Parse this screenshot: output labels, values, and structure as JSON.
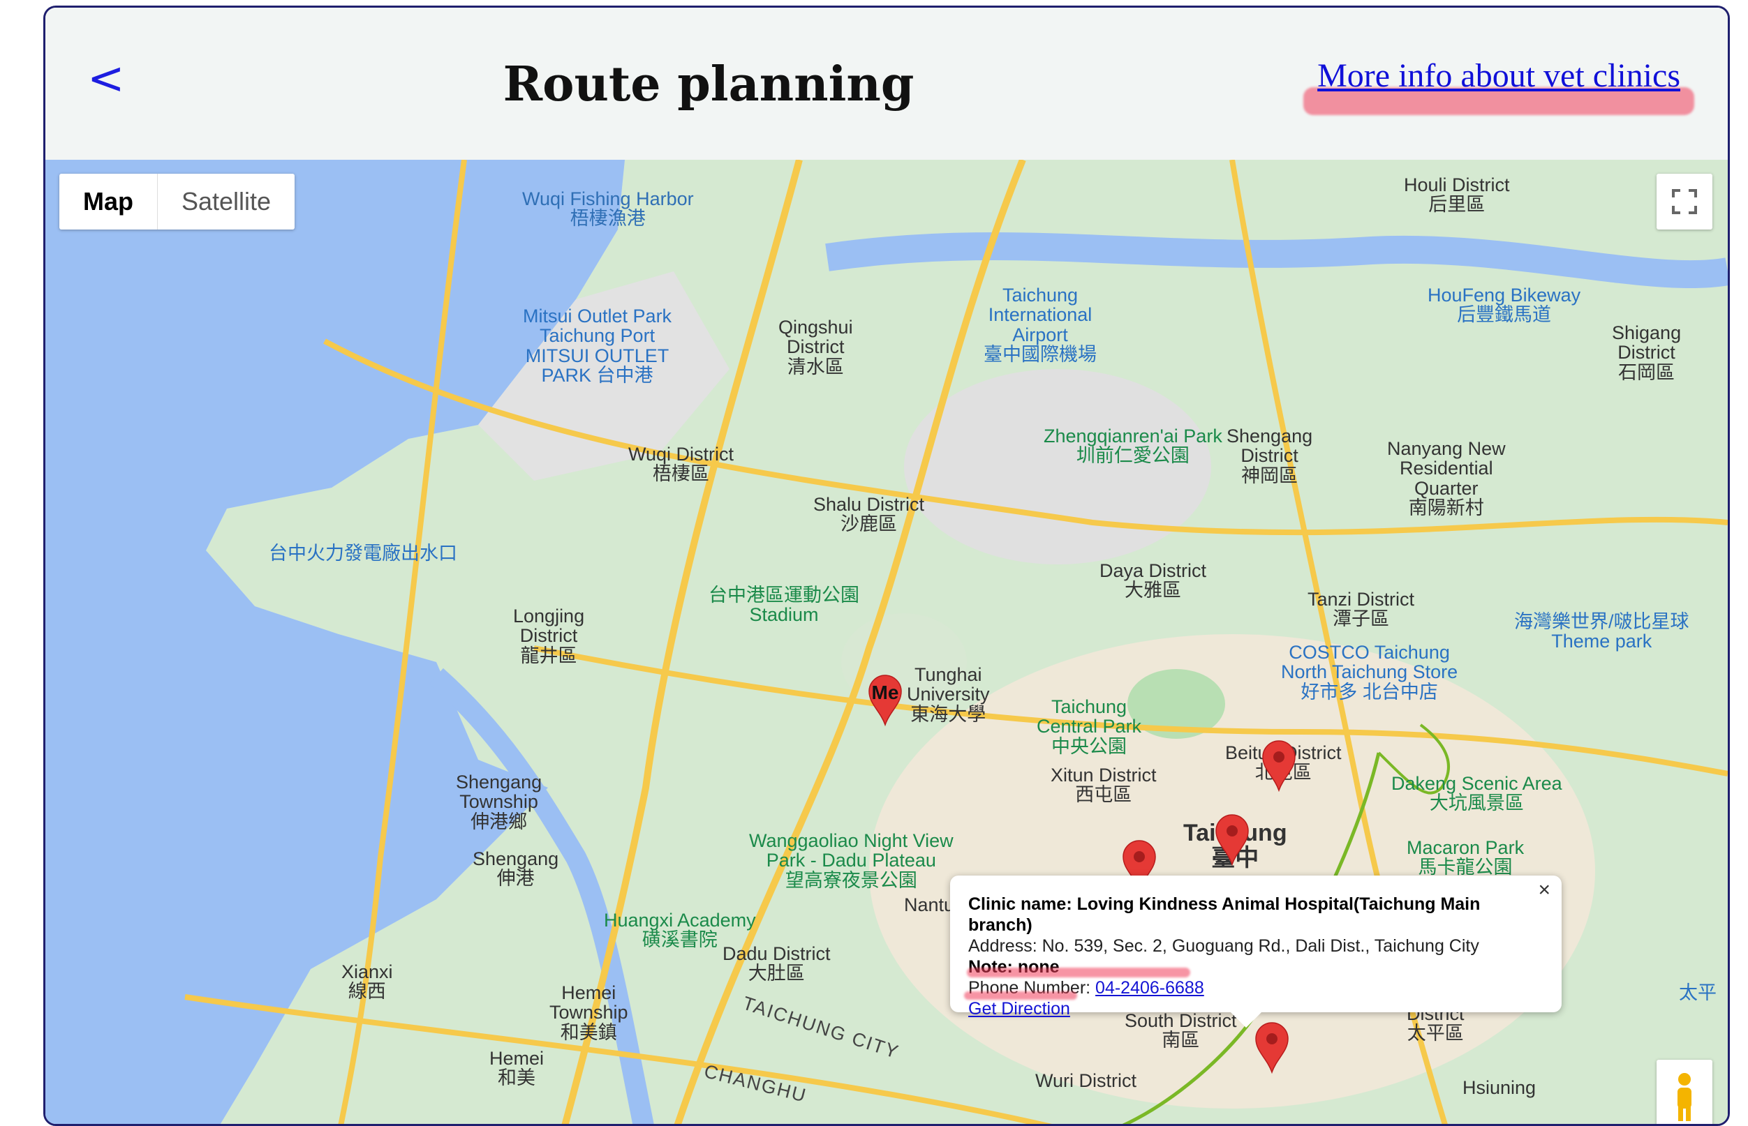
{
  "header": {
    "back_label": "<",
    "title": "Route planning",
    "more_info_link": "More info about vet clinics"
  },
  "map_controls": {
    "map_label": "Map",
    "satellite_label": "Satellite",
    "fullscreen_icon": "fullscreen-icon",
    "pegman_icon": "street-view-pegman-icon"
  },
  "markers": {
    "me_label": "Me"
  },
  "popup": {
    "close_label": "×",
    "clinic_line": "Clinic name: Loving Kindness Animal Hospital(Taichung Main branch)",
    "address_line": "Address: No. 539, Sec. 2, Guoguang Rd., Dali Dist., Taichung City",
    "note_line": "Note: none",
    "phone_prefix": "Phone Number: ",
    "phone_number": "04-2406-6688",
    "direction_link": "Get Direction"
  },
  "map_labels": [
    {
      "id": "wuqi-harbor",
      "text": "Wuqi Fishing Harbor\n梧棲漁港",
      "type": "water"
    },
    {
      "id": "mitsui",
      "text": "Mitsui Outlet Park\nTaichung Port\nMITSUI OUTLET\nPARK 台中港",
      "type": "poi"
    },
    {
      "id": "qingshui",
      "text": "Qingshui\nDistrict\n清水區",
      "type": "plain"
    },
    {
      "id": "wuqi-district",
      "text": "Wuqi District\n梧棲區",
      "type": "plain"
    },
    {
      "id": "shalu",
      "text": "Shalu District\n沙鹿區",
      "type": "plain"
    },
    {
      "id": "airport",
      "text": "Taichung\nInternational\nAirport\n臺中國際機場",
      "type": "poi"
    },
    {
      "id": "zhengqianren",
      "text": "Zhengqianren'ai Park\n圳前仁愛公園",
      "type": "park"
    },
    {
      "id": "shengang-d",
      "text": "Shengang\nDistrict\n神岡區",
      "type": "plain"
    },
    {
      "id": "houli",
      "text": "Houli District\n后里區",
      "type": "plain"
    },
    {
      "id": "houfeng",
      "text": "HouFeng Bikeway\n后豐鐵馬道",
      "type": "poi"
    },
    {
      "id": "shigang",
      "text": "Shigang\nDistrict\n石岡區",
      "type": "plain"
    },
    {
      "id": "nanyang",
      "text": "Nanyang New\nResidential\nQuarter\n南陽新村",
      "type": "plain"
    },
    {
      "id": "power-plant",
      "text": "台中火力發電廠出水口",
      "type": "poi"
    },
    {
      "id": "sports-park",
      "text": "台中港區運動公園\nStadium",
      "type": "park"
    },
    {
      "id": "longjing",
      "text": "Longjing\nDistrict\n龍井區",
      "type": "plain"
    },
    {
      "id": "daya",
      "text": "Daya District\n大雅區",
      "type": "plain"
    },
    {
      "id": "tanzi",
      "text": "Tanzi District\n潭子區",
      "type": "plain"
    },
    {
      "id": "water-world",
      "text": "海灣樂世界/啵比星球\nTheme park",
      "type": "poi"
    },
    {
      "id": "costco",
      "text": "COSTCO Taichung\nNorth Taichung Store\n好市多 北台中店",
      "type": "poi"
    },
    {
      "id": "tunghai",
      "text": "Tunghai\nUniversity\n東海大學",
      "type": "plain"
    },
    {
      "id": "central-park",
      "text": "Taichung\nCentral Park\n中央公園",
      "type": "park"
    },
    {
      "id": "beitun",
      "text": "Beitun District\n北屯區",
      "type": "plain"
    },
    {
      "id": "xitun",
      "text": "Xitun District\n西屯區",
      "type": "plain"
    },
    {
      "id": "dakeng",
      "text": "Dakeng Scenic Area\n大坑風景區",
      "type": "park"
    },
    {
      "id": "shengang-township",
      "text": "Shengang\nTownship\n伸港鄉",
      "type": "plain"
    },
    {
      "id": "shengang-town",
      "text": "Shengang\n伸港",
      "type": "plain"
    },
    {
      "id": "taichung",
      "text": "Taichung\n臺中",
      "type": "plain"
    },
    {
      "id": "macaron",
      "text": "Macaron Park\n馬卡龍公園",
      "type": "park"
    },
    {
      "id": "night-view",
      "text": "Wanggaoliao Night View\nPark - Dadu Plateau\n望高寮夜景公園",
      "type": "park"
    },
    {
      "id": "huangxi",
      "text": "Huangxi Academy\n磺溪書院",
      "type": "park"
    },
    {
      "id": "dadu",
      "text": "Dadu District\n大肚區",
      "type": "plain"
    },
    {
      "id": "nantun",
      "text": "Nantu",
      "type": "plain"
    },
    {
      "id": "xianxi",
      "text": "Xianxi\n線西",
      "type": "plain"
    },
    {
      "id": "hemei-township",
      "text": "Hemei\nTownship\n和美鎮",
      "type": "plain"
    },
    {
      "id": "hemei",
      "text": "Hemei\n和美",
      "type": "plain"
    },
    {
      "id": "taichung-city-road",
      "text": "TAICHUNG CITY",
      "type": "road"
    },
    {
      "id": "changhua",
      "text": "CHANGHU",
      "type": "road"
    },
    {
      "id": "south-district",
      "text": "South District\n南區",
      "type": "plain"
    },
    {
      "id": "taiping",
      "text": "District\n太平區",
      "type": "plain"
    },
    {
      "id": "wuri",
      "text": "Wuri District",
      "type": "plain"
    },
    {
      "id": "hsiuning",
      "text": "Hsiuning",
      "type": "plain"
    },
    {
      "id": "taiping-right",
      "text": "太平",
      "type": "poi"
    }
  ]
}
